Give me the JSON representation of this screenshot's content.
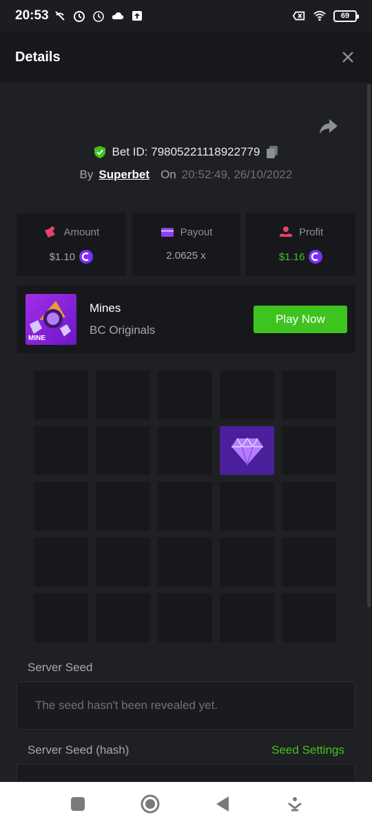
{
  "status_bar": {
    "time": "20:53",
    "battery": "69",
    "icons_left": [
      "wifi-calling-off-icon",
      "alarm-icon",
      "alarm-icon",
      "cloud-icon",
      "upload-icon"
    ],
    "icons_right": [
      "no-sim-icon",
      "wifi-icon",
      "battery-icon"
    ]
  },
  "header": {
    "title": "Details"
  },
  "bet": {
    "id_text": "Bet ID: 79805221118922779",
    "by_label": "By",
    "user": "Superbet",
    "on_label": "On",
    "timestamp": "20:52:49, 26/10/2022"
  },
  "stats": {
    "amount_label": "Amount",
    "amount_value": "$1.10",
    "payout_label": "Payout",
    "payout_value": "2.0625 x",
    "profit_label": "Profit",
    "profit_value": "$1.16"
  },
  "game": {
    "name": "Mines",
    "provider": "BC Originals",
    "thumb_label": "MINE",
    "play_label": "Play Now"
  },
  "mines_grid": {
    "rows": 5,
    "cols": 5,
    "revealed_gem_positions": [
      [
        1,
        3
      ]
    ]
  },
  "server_seed": {
    "label": "Server Seed",
    "value": "The seed hasn't been revealed yet."
  },
  "server_seed_hash": {
    "label": "Server Seed (hash)",
    "settings_link": "Seed Settings"
  },
  "colors": {
    "background": "#1f2023",
    "card": "#17181b",
    "accent_green": "#3ec41e",
    "coin_purple": "#7b2ff7",
    "gem_tile": "#4a1f9a"
  }
}
